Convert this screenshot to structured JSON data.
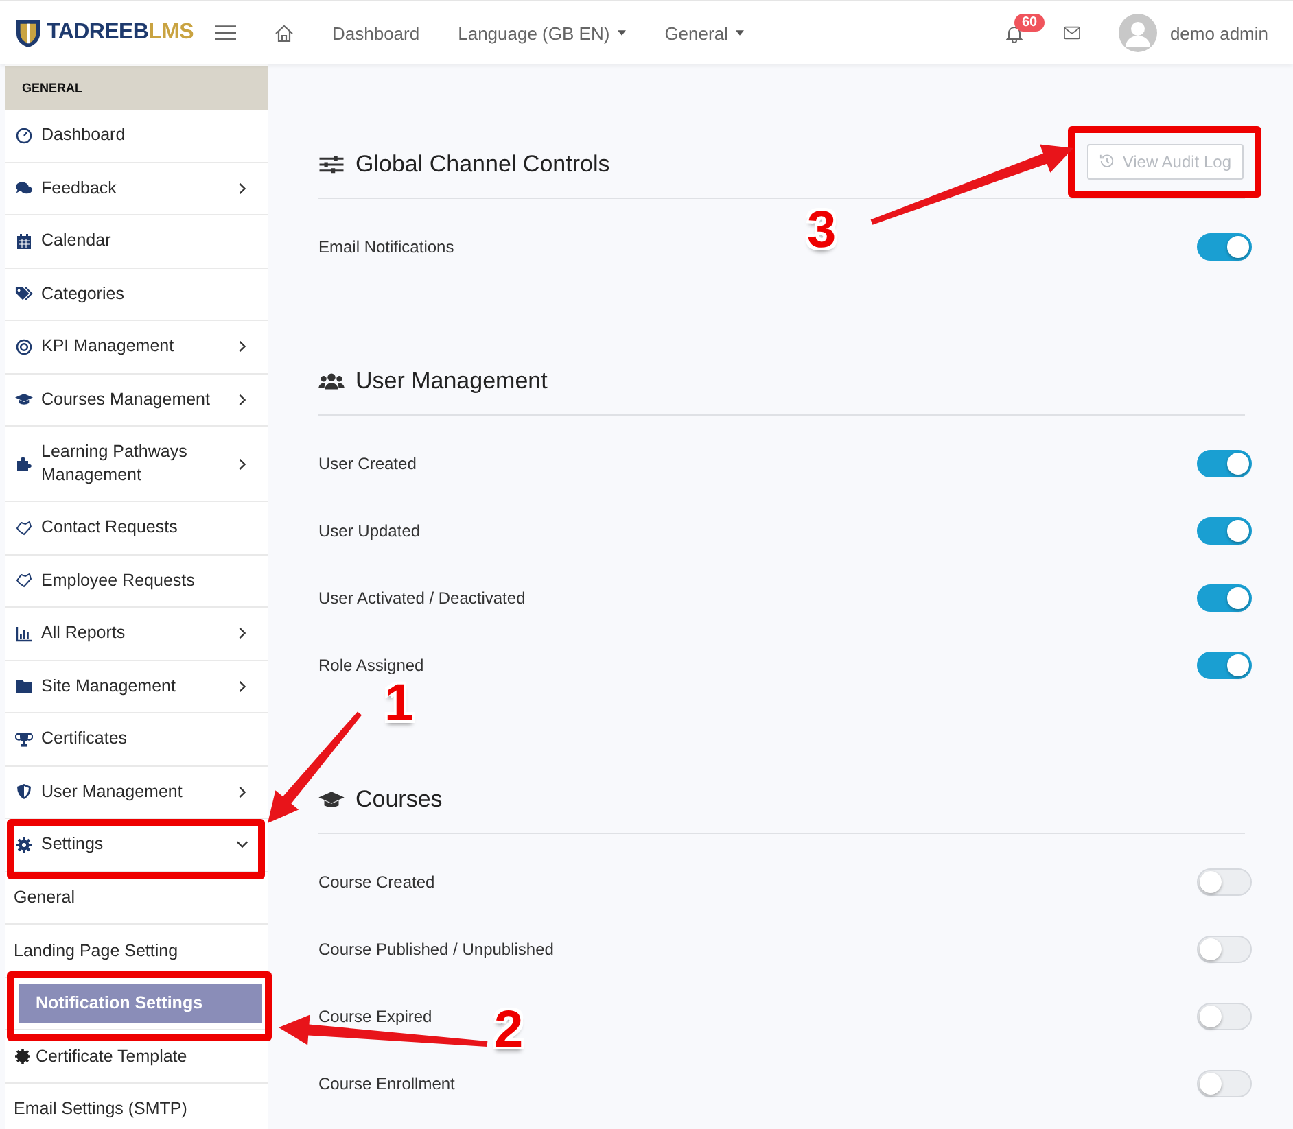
{
  "brand": {
    "name_main": "TADREEB",
    "name_accent": "LMS"
  },
  "topbar": {
    "nav": [
      {
        "label": "Dashboard",
        "dropdown": false
      },
      {
        "label": "Language (GB EN)",
        "dropdown": true
      },
      {
        "label": "General",
        "dropdown": true
      }
    ],
    "notification_count": "60",
    "user": "demo admin"
  },
  "sidebar": {
    "section": "GENERAL",
    "items": [
      {
        "label": "Dashboard"
      },
      {
        "label": "Feedback",
        "expanded": false
      },
      {
        "label": "Calendar"
      },
      {
        "label": "Categories"
      },
      {
        "label": "KPI Management",
        "expanded": false
      },
      {
        "label": "Courses Management",
        "expanded": false
      },
      {
        "label": "Learning Pathways Management",
        "expanded": false
      },
      {
        "label": "Contact Requests"
      },
      {
        "label": "Employee Requests"
      },
      {
        "label": "All Reports",
        "expanded": false
      },
      {
        "label": "Site Management",
        "expanded": false
      },
      {
        "label": "Certificates"
      },
      {
        "label": "User Management",
        "expanded": false
      },
      {
        "label": "Settings",
        "expanded": true,
        "children": [
          {
            "label": "General",
            "selected": false
          },
          {
            "label": "Landing Page Setting",
            "selected": false
          },
          {
            "label": "Notification Settings",
            "selected": true
          },
          {
            "label": "Certificate Template",
            "selected": false
          },
          {
            "label": "Email Settings (SMTP)",
            "selected": false
          }
        ]
      }
    ]
  },
  "audit_button": {
    "label": "View Audit Log",
    "disabled": true
  },
  "sections": [
    {
      "title": "Global Channel Controls",
      "rows": [
        {
          "label": "Email Notifications",
          "on": true
        }
      ]
    },
    {
      "title": "User Management",
      "rows": [
        {
          "label": "User Created",
          "on": true
        },
        {
          "label": "User Updated",
          "on": true
        },
        {
          "label": "User Activated / Deactivated",
          "on": true
        },
        {
          "label": "Role Assigned",
          "on": true
        }
      ]
    },
    {
      "title": "Courses",
      "rows": [
        {
          "label": "Course Created",
          "on": false
        },
        {
          "label": "Course Published / Unpublished",
          "on": false
        },
        {
          "label": "Course Expired",
          "on": false
        },
        {
          "label": "Course Enrollment",
          "on": false
        }
      ]
    }
  ],
  "annotations": [
    {
      "number": "1"
    },
    {
      "number": "2"
    },
    {
      "number": "3"
    }
  ]
}
